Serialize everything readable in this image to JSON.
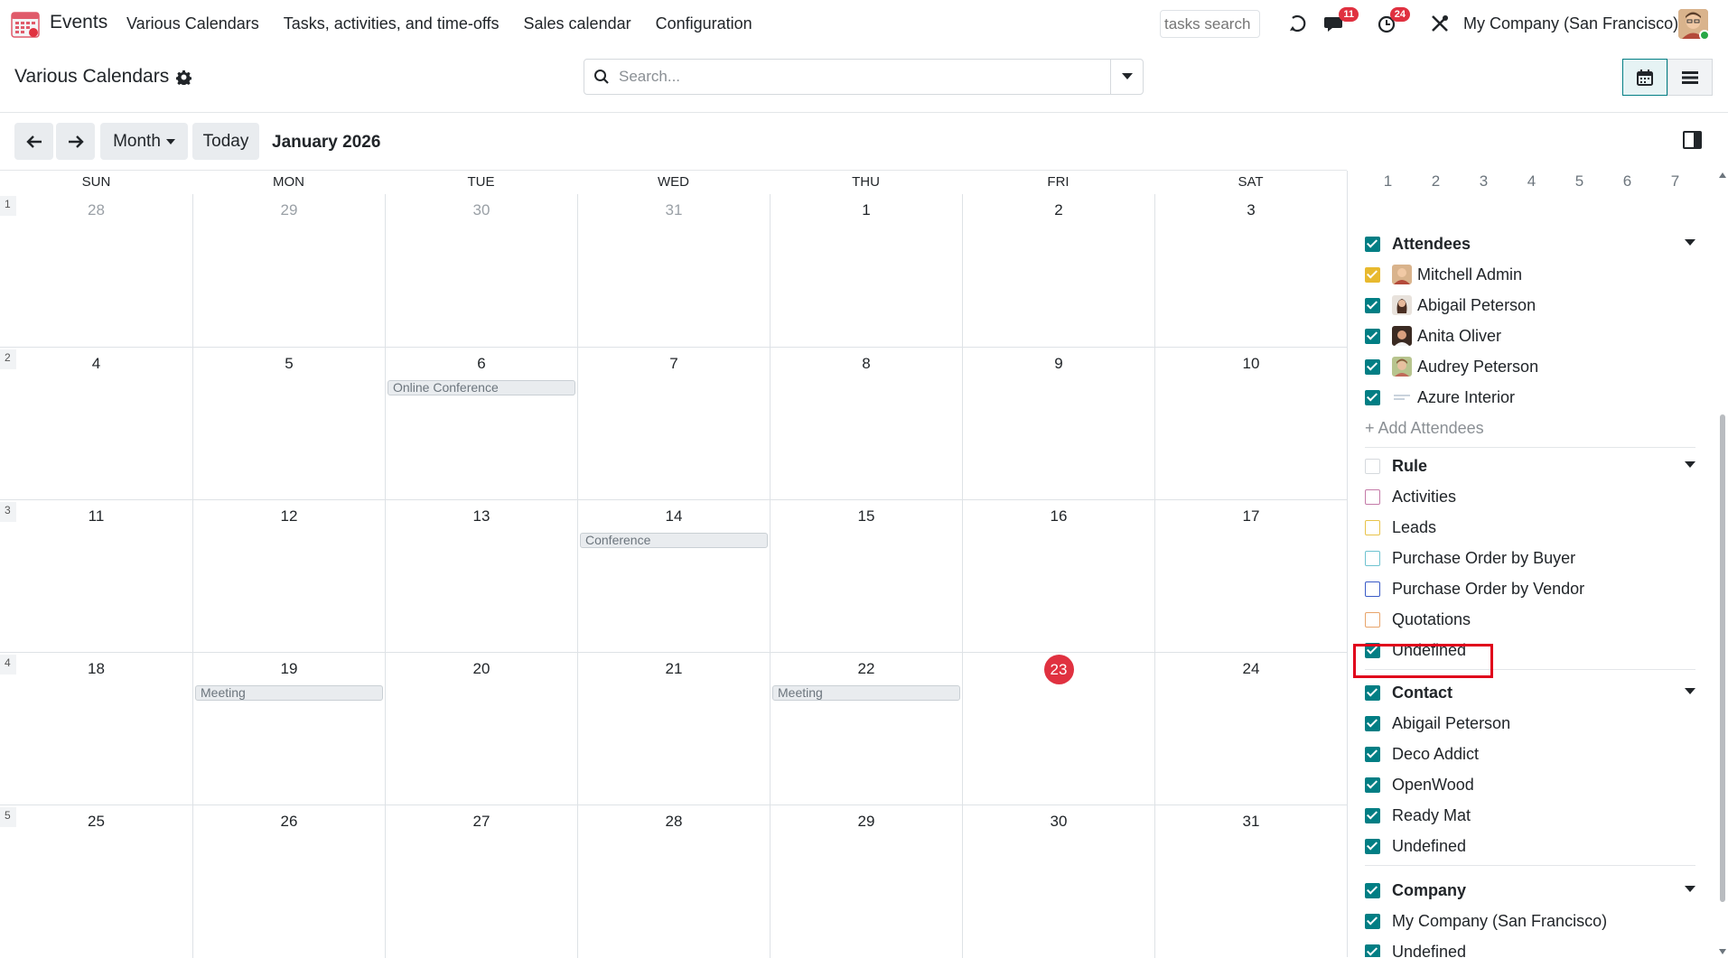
{
  "navbar": {
    "app_name": "Events",
    "menu": [
      "Various Calendars",
      "Tasks, activities, and time-offs",
      "Sales calendar",
      "Configuration"
    ],
    "tasks_search_placeholder": "tasks search",
    "messages_badge": "11",
    "activities_badge": "24",
    "company": "My Company (San Francisco)"
  },
  "control_panel": {
    "title": "Various Calendars",
    "search_placeholder": "Search..."
  },
  "toolbar": {
    "scale_label": "Month",
    "today_label": "Today",
    "range_label": "January 2026"
  },
  "calendar": {
    "day_headers": [
      "SUN",
      "MON",
      "TUE",
      "WED",
      "THU",
      "FRI",
      "SAT"
    ],
    "weeks": [
      {
        "num": "1",
        "days": [
          "28",
          "29",
          "30",
          "31",
          "1",
          "2",
          "3"
        ]
      },
      {
        "num": "2",
        "days": [
          "4",
          "5",
          "6",
          "7",
          "8",
          "9",
          "10"
        ]
      },
      {
        "num": "3",
        "days": [
          "11",
          "12",
          "13",
          "14",
          "15",
          "16",
          "17"
        ]
      },
      {
        "num": "4",
        "days": [
          "18",
          "19",
          "20",
          "21",
          "22",
          "23",
          "24"
        ]
      },
      {
        "num": "5",
        "days": [
          "25",
          "26",
          "27",
          "28",
          "29",
          "30",
          "31"
        ]
      }
    ],
    "events": {
      "online_conference": "Online Conference",
      "conference": "Conference",
      "meeting_mon": "Meeting",
      "meeting_thu": "Meeting"
    }
  },
  "sidebar": {
    "mini_week": [
      "1",
      "2",
      "3",
      "4",
      "5",
      "6",
      "7"
    ],
    "attendees": {
      "title": "Attendees",
      "items": [
        "Mitchell Admin",
        "Abigail Peterson",
        "Anita Oliver",
        "Audrey Peterson",
        "Azure Interior"
      ],
      "add_label": "+ Add Attendees"
    },
    "rule": {
      "title": "Rule",
      "items": [
        "Activities",
        "Leads",
        "Purchase Order by Buyer",
        "Purchase Order by Vendor",
        "Quotations",
        "Undefined"
      ]
    },
    "contact": {
      "title": "Contact",
      "items": [
        "Abigail Peterson",
        "Deco Addict",
        "OpenWood",
        "Ready Mat",
        "Undefined"
      ]
    },
    "company": {
      "title": "Company",
      "items": [
        "My Company (San Francisco)",
        "Undefined"
      ]
    }
  },
  "colors": {
    "accent": "#017e84",
    "today": "#e03140",
    "badge": "#e03140",
    "highlight": "#e0001b"
  }
}
